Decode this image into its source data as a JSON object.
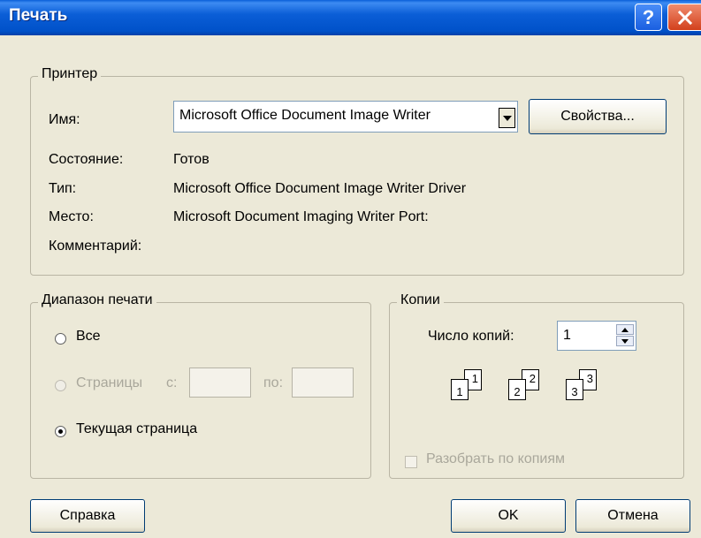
{
  "window": {
    "title": "Печать"
  },
  "printer": {
    "legend": "Принтер",
    "name_label": "Имя:",
    "name_value": "Microsoft Office Document Image Writer",
    "properties_button": "Свойства...",
    "status_label": "Состояние:",
    "status_value": "Готов",
    "type_label": "Тип:",
    "type_value": "Microsoft Office Document Image Writer Driver",
    "location_label": "Место:",
    "location_value": "Microsoft Document Imaging Writer Port:",
    "comment_label": "Комментарий:"
  },
  "range": {
    "legend": "Диапазон печати",
    "all_label": "Все",
    "pages_label": "Страницы",
    "from_label": "с:",
    "to_label": "по:",
    "current_label": "Текущая страница",
    "selected": "current"
  },
  "copies": {
    "legend": "Копии",
    "count_label": "Число копий:",
    "count_value": "1",
    "collate_label": "Разобрать по копиям",
    "collate_checked": false,
    "pages": [
      "1",
      "1",
      "2",
      "2",
      "3",
      "3"
    ]
  },
  "footer": {
    "help_button": "Справка",
    "ok_button": "OK",
    "cancel_button": "Отмена"
  },
  "icons": [
    "help-icon",
    "close-icon",
    "dropdown-arrow-icon",
    "spin-up-icon",
    "spin-down-icon"
  ]
}
